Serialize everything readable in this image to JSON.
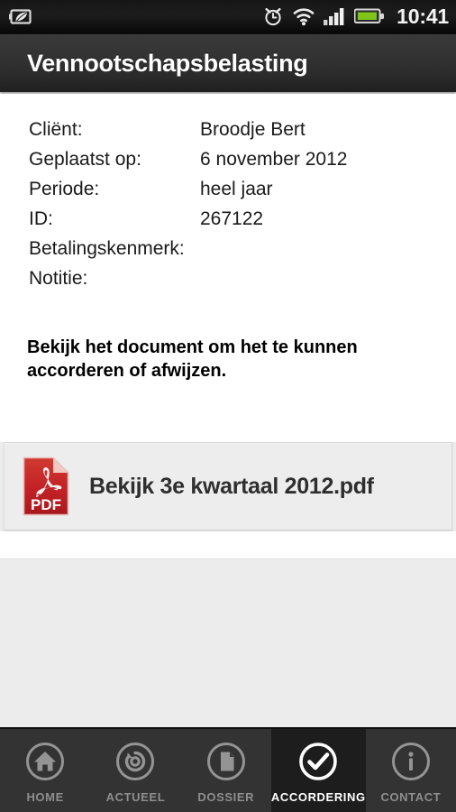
{
  "statusbar": {
    "eco_battery_icon": "battery-eco-icon",
    "alarm_icon": "alarm-clock-icon",
    "wifi_icon": "wifi-icon",
    "signal_icon": "signal-bars-icon",
    "battery_icon": "battery-icon",
    "time": "10:41"
  },
  "header": {
    "title": "Vennootschapsbelasting"
  },
  "details": {
    "fields": [
      {
        "label": "Cliënt:",
        "value": "Broodje Bert"
      },
      {
        "label": "Geplaatst op:",
        "value": "6 november 2012"
      },
      {
        "label": "Periode:",
        "value": "heel jaar"
      },
      {
        "label": "ID:",
        "value": "267122"
      },
      {
        "label": "Betalingskenmerk:",
        "value": ""
      },
      {
        "label": "Notitie:",
        "value": ""
      }
    ],
    "notice": "Bekijk het document om het te kunnen accorderen of afwijzen."
  },
  "document": {
    "icon": "pdf-file-icon",
    "icon_badge": "PDF",
    "label": "Bekijk 3e kwartaal 2012.pdf"
  },
  "tabbar": {
    "items": [
      {
        "label": "HOME",
        "icon": "home-icon",
        "active": false
      },
      {
        "label": "ACTUEEL",
        "icon": "refresh-icon",
        "active": false
      },
      {
        "label": "DOSSIER",
        "icon": "document-icon",
        "active": false
      },
      {
        "label": "ACCORDERING",
        "icon": "check-circle-icon",
        "active": true
      },
      {
        "label": "CONTACT",
        "icon": "info-icon",
        "active": false
      }
    ]
  },
  "colors": {
    "titlebar": "#333333",
    "tabbar": "#333333",
    "tab_active_bg": "#1d1d1d",
    "tab_inactive_text": "#8e8e8e",
    "pdf_red": "#c32025",
    "page_bg": "#ececec",
    "battery_green": "#7fc41b"
  }
}
